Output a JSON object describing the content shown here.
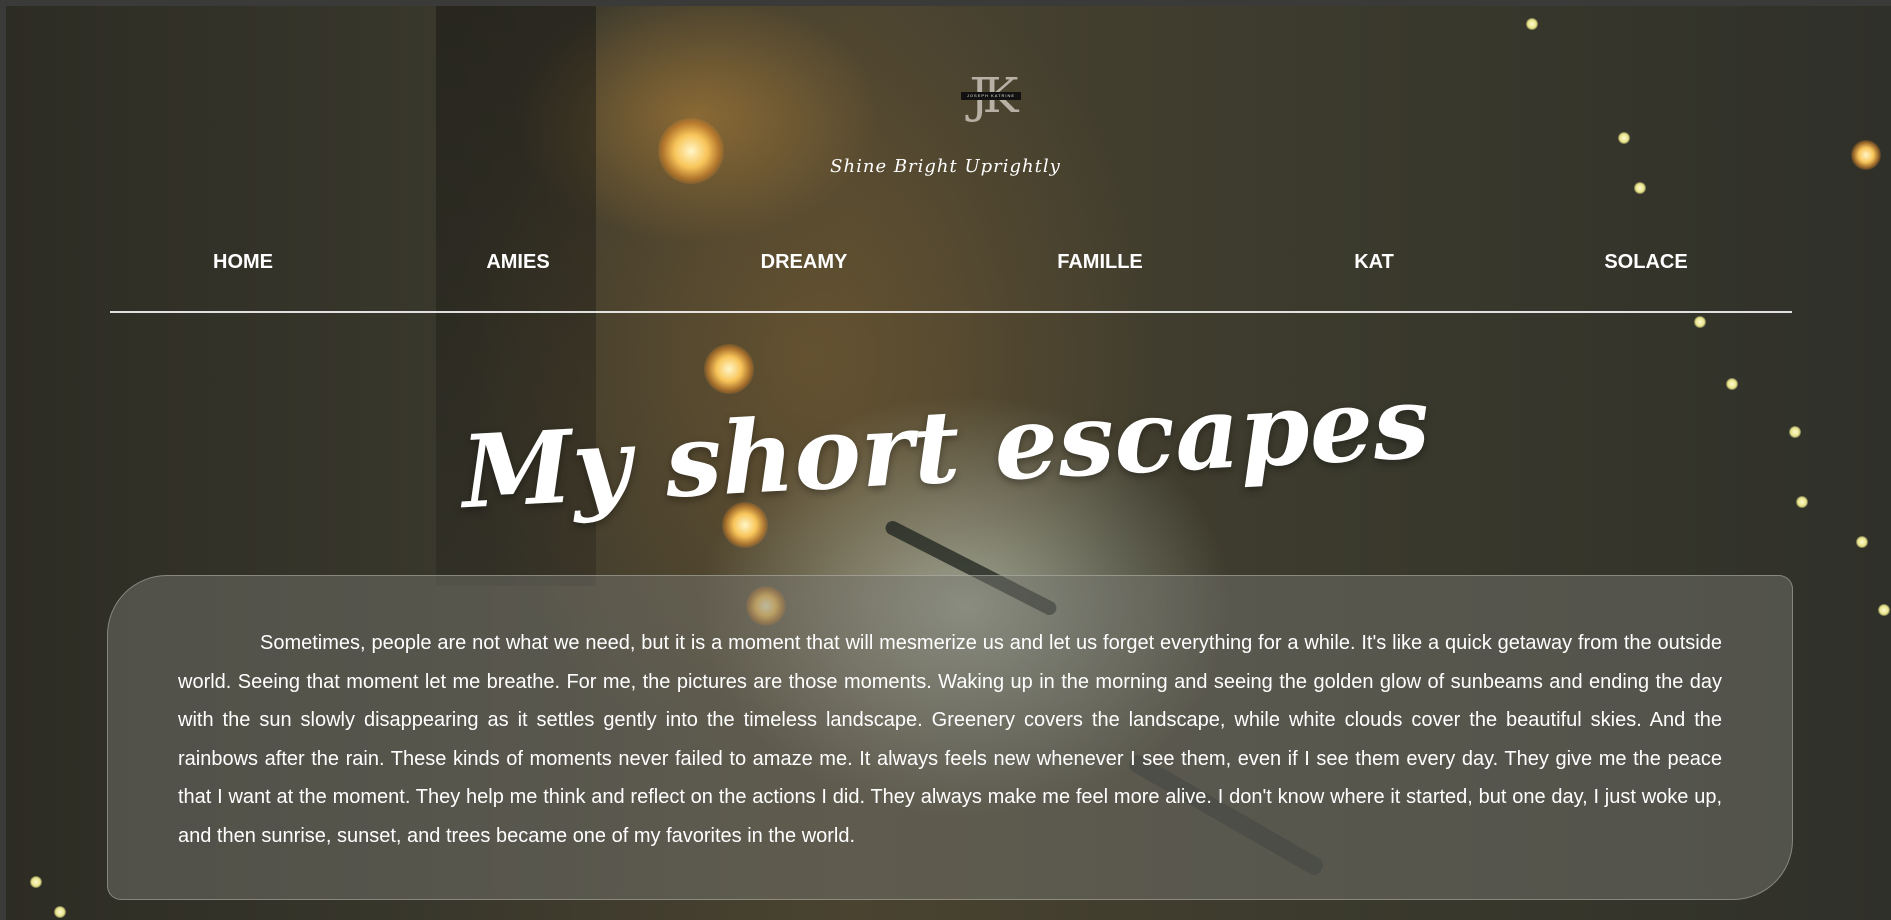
{
  "header": {
    "logo": {
      "monogram": "JK",
      "band_text": "JOSEPH KATRINE"
    },
    "tagline": "Shine Bright Uprightly"
  },
  "nav": {
    "items": [
      {
        "label": "HOME"
      },
      {
        "label": "AMIES"
      },
      {
        "label": "DREAMY"
      },
      {
        "label": "FAMILLE"
      },
      {
        "label": "KAT"
      },
      {
        "label": "SOLACE"
      }
    ]
  },
  "main": {
    "heading": "My short escapes",
    "paragraph": "Sometimes, people are not what we need, but it is a moment that will mesmerize us and let us forget everything for a while. It's like a quick getaway from the outside world. Seeing that moment let me breathe. For me, the pictures are those moments. Waking up in the morning and seeing the golden glow of sunbeams and ending the day with the sun slowly disappearing as it settles gently into the timeless landscape. Greenery covers the landscape, while white clouds cover the beautiful skies. And the rainbows after the rain. These kinds of moments never failed to amaze me. It always feels new whenever I see them, even if I see them every day. They give me the peace that I want at the moment. They help me think and reflect on the actions I did. They always make me feel more alive. I don't know where it started, but one day, I just woke up, and then sunrise, sunset, and trees became one of my favorites in the world."
  },
  "background": {
    "image": "night-string-lights-photo",
    "colors": {
      "base": "#37362b",
      "glow": "#f8c55a",
      "text": "#ffffff"
    }
  }
}
